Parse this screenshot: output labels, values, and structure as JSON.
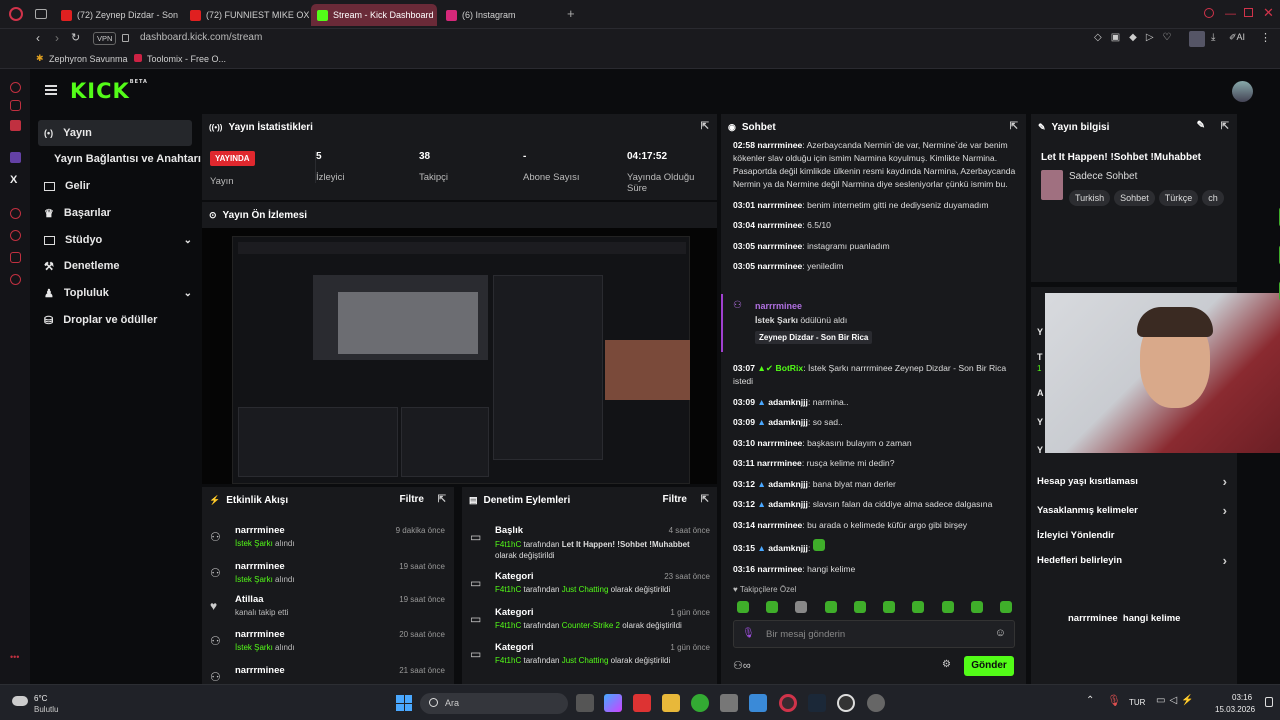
{
  "browser": {
    "tabs": [
      {
        "label": "(72) Zeynep Dizdar - Son Bir",
        "color": "#e02020"
      },
      {
        "label": "(72) FUNNIEST MIKE OXLO",
        "color": "#e02020"
      },
      {
        "label": "Stream - Kick Dashboard",
        "color": "#53fc18"
      },
      {
        "label": "(6) Instagram",
        "color": "#d6287a"
      }
    ],
    "url": "dashboard.kick.com/stream",
    "vpn": "VPN",
    "ai": "AI",
    "bookmarks": [
      "Zephyron Savunma",
      "Toolomix - Free O..."
    ]
  },
  "brand": {
    "logo": "KICK",
    "beta": "BETA"
  },
  "nav": [
    {
      "label": "Yayın",
      "icon": "broadcast-icon"
    },
    {
      "label": "Yayın Bağlantısı ve Anahtarı",
      "icon": ""
    },
    {
      "label": "Gelir",
      "icon": "revenue-icon"
    },
    {
      "label": "Başarılar",
      "icon": "trophy-icon"
    },
    {
      "label": "Stüdyo",
      "icon": "studio-icon"
    },
    {
      "label": "Denetleme",
      "icon": "moderation-icon"
    },
    {
      "label": "Topluluk",
      "icon": "community-icon"
    },
    {
      "label": "Droplar ve ödüller",
      "icon": "drops-icon"
    }
  ],
  "stats": {
    "title": "Yayın İstatistikleri",
    "live_badge": "YAYINDA",
    "live_label": "Yayın",
    "items": [
      {
        "value": "5",
        "label": "İzleyici"
      },
      {
        "value": "38",
        "label": "Takipçi"
      },
      {
        "value": "-",
        "label": "Abone Sayısı"
      },
      {
        "value": "04:17:52",
        "label": "Yayında Olduğu Süre"
      }
    ]
  },
  "preview": {
    "title": "Yayın Ön İzlemesi"
  },
  "activity": {
    "title": "Etkinlik Akışı",
    "filter": "Filtre",
    "rows": [
      {
        "name": "narrrminee",
        "action": "İstek Şarkı",
        "suffix": "alındı",
        "time": "9 dakika önce"
      },
      {
        "name": "narrrminee",
        "action": "İstek Şarkı",
        "suffix": "alındı",
        "time": "19 saat önce"
      },
      {
        "name": "Atillaa",
        "action": "",
        "suffix": "kanalı takip etti",
        "time": "19 saat önce"
      },
      {
        "name": "narrrminee",
        "action": "İstek Şarkı",
        "suffix": "alındı",
        "time": "20 saat önce"
      },
      {
        "name": "narrrminee",
        "action": "",
        "suffix": "",
        "time": "21 saat önce"
      }
    ]
  },
  "moderation": {
    "title": "Denetim Eylemleri",
    "filter": "Filtre",
    "rows": [
      {
        "name": "Başlık",
        "user": "F4t1hC",
        "mid": "tarafından",
        "value": "Let It Happen! !Sohbet !Muhabbet",
        "suffix": "olarak değiştirildi",
        "time": "4 saat önce"
      },
      {
        "name": "Kategori",
        "user": "F4t1hC",
        "mid": "tarafından",
        "value": "Just Chatting",
        "suffix": "olarak değiştirildi",
        "time": "23 saat önce"
      },
      {
        "name": "Kategori",
        "user": "F4t1hC",
        "mid": "tarafından",
        "value": "Counter-Strike 2",
        "suffix": "olarak değiştirildi",
        "time": "1 gün önce"
      },
      {
        "name": "Kategori",
        "user": "F4t1hC",
        "mid": "tarafından",
        "value": "Just Chatting",
        "suffix": "olarak değiştirildi",
        "time": "1 gün önce"
      }
    ]
  },
  "chat": {
    "title": "Sohbet",
    "first_msg": {
      "time": "02:58",
      "user": "narrrminee",
      "text": "Azerbaycanda Nermin`de var, Nermine`de var benim kökenler slav olduğu için ismim Narmina koyulmuş. Kimlikte Narmina. Pasaportda değil kimlikde ülkenin resmi kaydında Narmina, Azerbaycanda Nermin ya da Nermine değil Narmina diye sesleniyorlar çünkü ismim bu."
    },
    "messages_a": [
      {
        "time": "03:01",
        "user": "narrrminee",
        "text": "benim internetim gitti ne dediyseniz duyamadım"
      },
      {
        "time": "03:04",
        "user": "narrrminee",
        "text": "6.5/10"
      },
      {
        "time": "03:05",
        "user": "narrrminee",
        "text": "instagramı puanladım"
      },
      {
        "time": "03:05",
        "user": "narrrminee",
        "text": "yeniledim"
      }
    ],
    "redeem": {
      "user": "narrrminee",
      "action": "İstek Şarkı",
      "suffix": "ödülünü aldı",
      "song": "Zeynep Dizdar - Son Bir Rica"
    },
    "bot": {
      "time": "03:07",
      "user": "BotRix",
      "text": "İstek Şarkı narrrminee Zeynep Dizdar - Son Bir Rica istedi"
    },
    "messages_b": [
      {
        "time": "03:09",
        "user": "adamknjjj",
        "text": "narmina.."
      },
      {
        "time": "03:09",
        "user": "adamknjjj",
        "text": "so sad.."
      },
      {
        "time": "03:10",
        "user": "narrrminee",
        "text": "başkasını bulayım o zaman"
      },
      {
        "time": "03:11",
        "user": "narrrminee",
        "text": "rusça kelime mi dedin?"
      },
      {
        "time": "03:12",
        "user": "adamknjjj",
        "text": "bana blyat man derler"
      },
      {
        "time": "03:12",
        "user": "adamknjjj",
        "text": "slavsın falan da ciddiye alma sadece dalgasına"
      },
      {
        "time": "03:14",
        "user": "narrrminee",
        "text": "bu arada o kelimede küfür argo gibi birşey"
      },
      {
        "time": "03:15",
        "user": "adamknjjj",
        "text": ""
      },
      {
        "time": "03:16",
        "user": "narrrminee",
        "text": "hangi kelime"
      }
    ],
    "emote_label": "Takipçilere Özel",
    "input_placeholder": "Bir mesaj gönderin",
    "send": "Gönder"
  },
  "info": {
    "title": "Yayın bilgisi",
    "stream_title": "Let It Happen! !Sohbet !Muhabbet",
    "category": "Sadece Sohbet",
    "tags": [
      "Turkish",
      "Sohbet",
      "Türkçe",
      "ch"
    ]
  },
  "settings": {
    "items": [
      "Hesap yaşı kısıtlaması",
      "Yasaklanmış kelimeler",
      "İzleyici Yönlendir",
      "Hedefleri belirleyin"
    ],
    "chat_user": "narrrminee",
    "chat_text": "hangi kelime",
    "partial_letters": [
      "Y",
      "T",
      "1",
      "A",
      "Y",
      "Y"
    ]
  },
  "taskbar": {
    "temp": "6°C",
    "weather": "Bulutlu",
    "search": "Ara",
    "lang": "TUR",
    "time": "03:16",
    "date": "15.03.2026"
  }
}
